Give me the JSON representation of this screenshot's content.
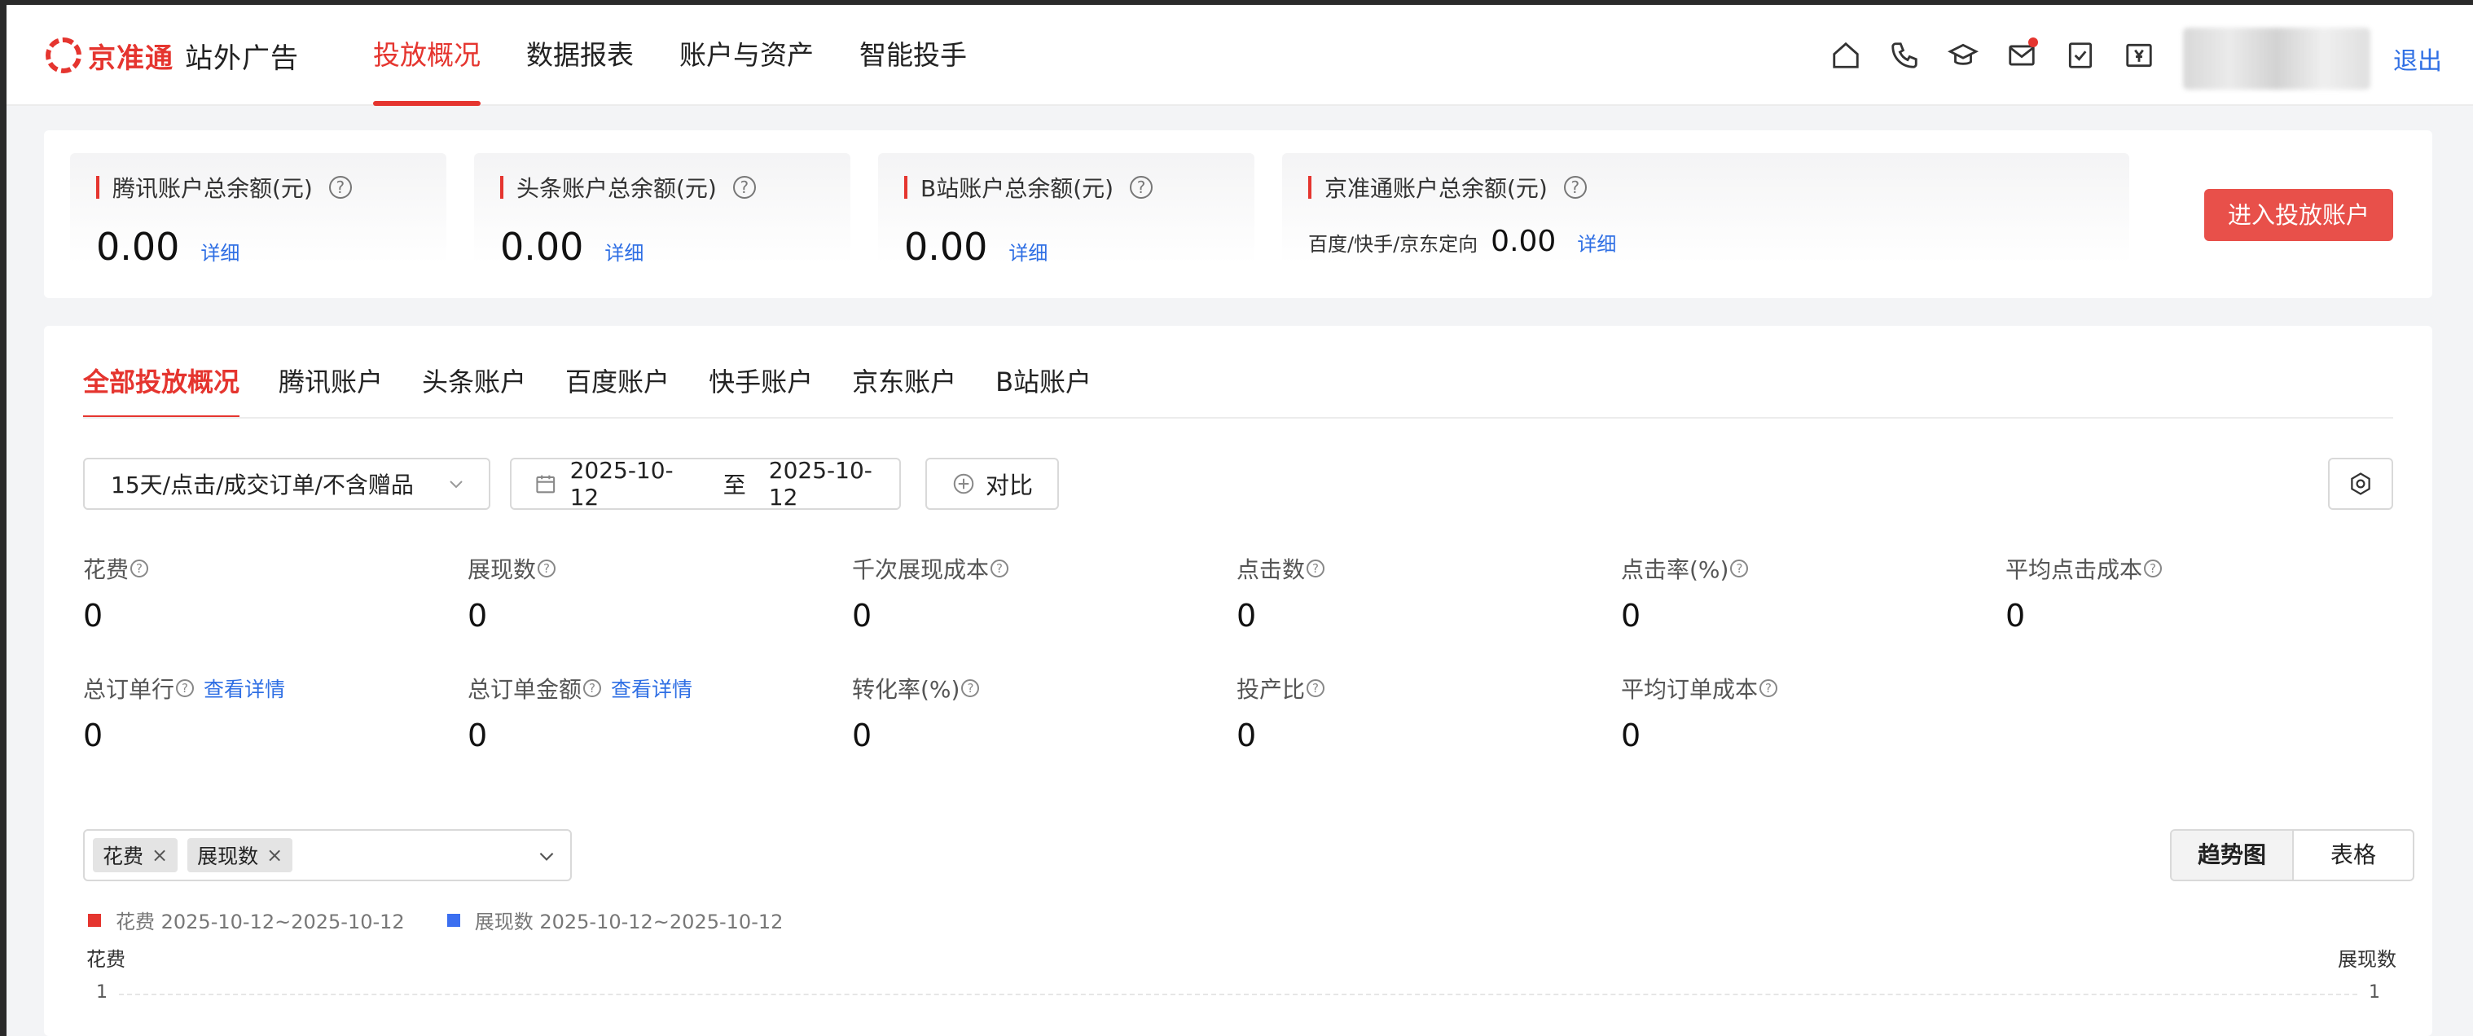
{
  "header": {
    "brand": "京准通",
    "product": "站外广告",
    "nav": [
      "投放概况",
      "数据报表",
      "账户与资产",
      "智能投手"
    ],
    "active_nav": 0,
    "icons": [
      "home-icon",
      "phone-icon",
      "graduation-cap-icon",
      "mail-icon",
      "task-icon",
      "yen-icon"
    ],
    "logout": "退出"
  },
  "balances": [
    {
      "title": "腾讯账户总余额(元)",
      "value": "0.00",
      "link": "详细"
    },
    {
      "title": "头条账户总余额(元)",
      "value": "0.00",
      "link": "详细"
    },
    {
      "title": "B站账户总余额(元)",
      "value": "0.00",
      "link": "详细"
    },
    {
      "title": "京准通账户总余额(元)",
      "prefix": "百度/快手/京东定向",
      "value": "0.00",
      "link": "详细"
    }
  ],
  "qmark": "?",
  "enter_button": "进入投放账户",
  "tabs": [
    "全部投放概况",
    "腾讯账户",
    "头条账户",
    "百度账户",
    "快手账户",
    "京东账户",
    "B站账户"
  ],
  "active_tab": 0,
  "filter": {
    "preset": "15天/点击/成交订单/不含赠品",
    "date_start": "2025-10-12",
    "date_sep": "至",
    "date_end": "2025-10-12",
    "compare": "对比"
  },
  "metrics_row1": [
    {
      "label": "花费",
      "value": "0"
    },
    {
      "label": "展现数",
      "value": "0"
    },
    {
      "label": "千次展现成本",
      "value": "0"
    },
    {
      "label": "点击数",
      "value": "0"
    },
    {
      "label": "点击率(%)",
      "value": "0"
    },
    {
      "label": "平均点击成本",
      "value": "0"
    }
  ],
  "metrics_row2": [
    {
      "label": "总订单行",
      "value": "0",
      "detail": "查看详情"
    },
    {
      "label": "总订单金额",
      "value": "0",
      "detail": "查看详情"
    },
    {
      "label": "转化率(%)",
      "value": "0"
    },
    {
      "label": "投产比",
      "value": "0"
    },
    {
      "label": "平均订单成本",
      "value": "0"
    }
  ],
  "chart_controls": {
    "tags": [
      "花费",
      "展现数"
    ],
    "tag_close": "×",
    "view_modes": [
      "趋势图",
      "表格"
    ],
    "active_view": 0
  },
  "colors": {
    "accent": "#e5352f",
    "link": "#2f6fe4",
    "series_cost": "#e5352f",
    "series_impr": "#3b6ff0"
  },
  "chart_data": {
    "type": "line",
    "series": [
      {
        "name": "花费 2025-10-12~2025-10-12",
        "values": []
      },
      {
        "name": "展现数 2025-10-12~2025-10-12",
        "values": []
      }
    ],
    "ylabel": "花费",
    "y2label": "展现数",
    "y_ticks": [
      "1"
    ],
    "y2_ticks": [
      "1"
    ],
    "legend": "top-left"
  }
}
